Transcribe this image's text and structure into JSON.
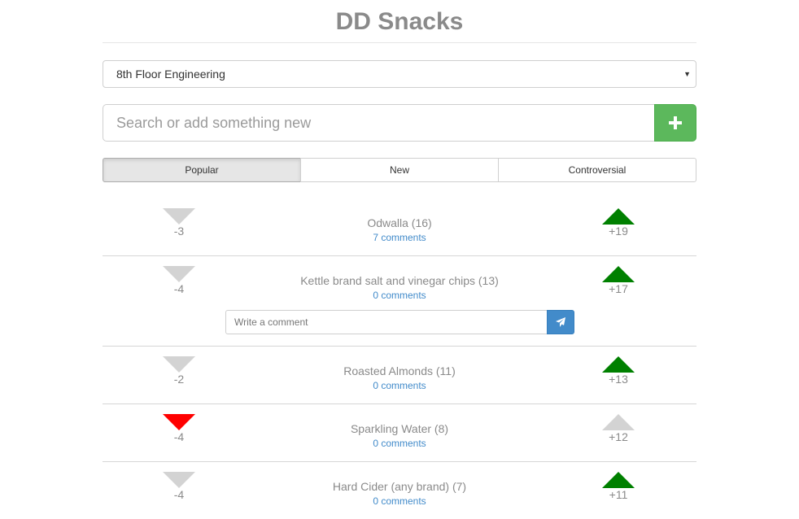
{
  "app": {
    "title": "DD Snacks"
  },
  "group_select": {
    "selected": "8th Floor Engineering"
  },
  "search": {
    "placeholder": "Search or add something new"
  },
  "tabs": [
    {
      "label": "Popular",
      "active": true
    },
    {
      "label": "New",
      "active": false
    },
    {
      "label": "Controversial",
      "active": false
    }
  ],
  "comment_box": {
    "placeholder": "Write a comment"
  },
  "colors": {
    "add_button": "#5cb85c",
    "upvote": "#008000",
    "downvote_active": "#ff0000",
    "neutral_arrow": "#d3d3d3",
    "link": "#428bca",
    "send_button": "#428bca"
  },
  "items": [
    {
      "name": "Odwalla (16)",
      "comments": "7 comments",
      "downvotes": "-3",
      "upvotes": "+19",
      "down_state": "neutral",
      "up_state": "active"
    },
    {
      "name": "Kettle brand salt and vinegar chips (13)",
      "comments": "0 comments",
      "downvotes": "-4",
      "upvotes": "+17",
      "down_state": "neutral",
      "up_state": "active"
    },
    {
      "name": "Roasted Almonds (11)",
      "comments": "0 comments",
      "downvotes": "-2",
      "upvotes": "+13",
      "down_state": "neutral",
      "up_state": "active"
    },
    {
      "name": "Sparkling Water (8)",
      "comments": "0 comments",
      "downvotes": "-4",
      "upvotes": "+12",
      "down_state": "active",
      "up_state": "neutral"
    },
    {
      "name": "Hard Cider (any brand) (7)",
      "comments": "0 comments",
      "downvotes": "-4",
      "upvotes": "+11",
      "down_state": "neutral",
      "up_state": "active"
    }
  ]
}
